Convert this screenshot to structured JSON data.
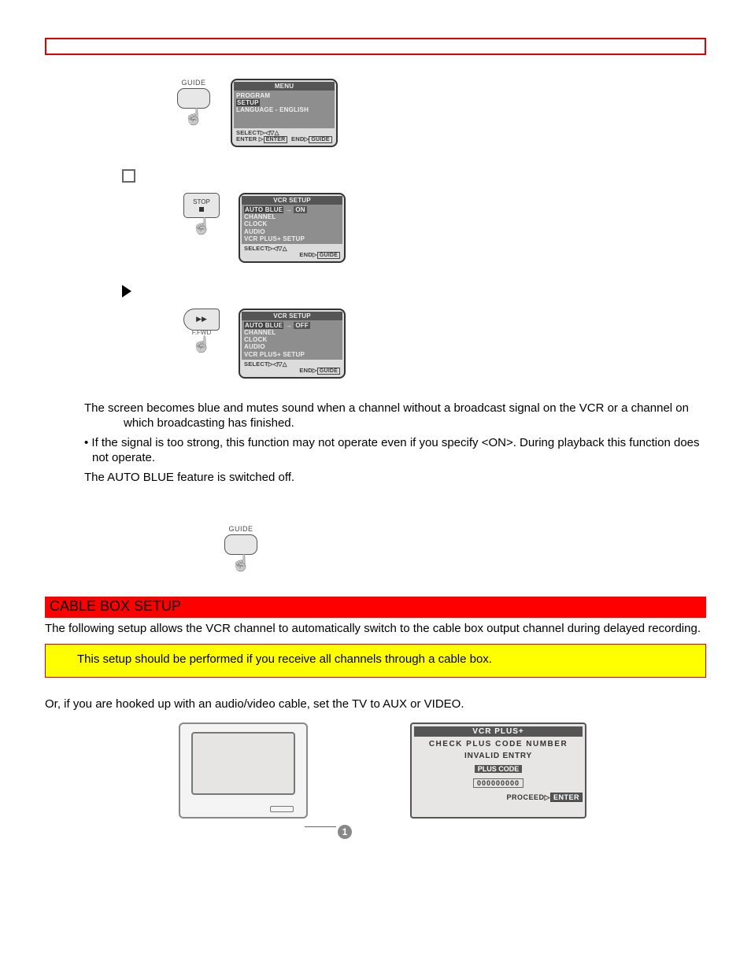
{
  "step1": {
    "remote_label": "GUIDE",
    "osd_title": "MENU",
    "items": [
      "PROGRAM",
      "SETUP",
      "LANGUAGE - ENGLISH"
    ],
    "footer_line1_a": "SELECT",
    "footer_line1_b": "",
    "footer_line2_a": "ENTER",
    "footer_line2_btn1": "ENTER",
    "footer_line2_b": "END",
    "footer_line2_btn2": "GUIDE"
  },
  "step2": {
    "remote_label": "STOP",
    "osd_title": "VCR SETUP",
    "item_sel": "AUTO BLUE",
    "item_val": "ON",
    "items_rest": [
      "CHANNEL",
      "CLOCK",
      "AUDIO",
      "VCR PLUS+  SETUP"
    ],
    "footer_a": "SELECT",
    "footer_end": "END",
    "footer_btn": "GUIDE"
  },
  "step3": {
    "remote_label": "F.FWD",
    "osd_title": "VCR SETUP",
    "item_sel": "AUTO BLUE",
    "item_val": "OFF",
    "items_rest": [
      "CHANNEL",
      "CLOCK",
      "AUDIO",
      "VCR PLUS+  SETUP"
    ],
    "footer_a": "SELECT",
    "footer_end": "END",
    "footer_btn": "GUIDE"
  },
  "notes": {
    "line1": "The screen becomes blue and mutes sound when a channel without a broadcast signal on the VCR or a channel on which broadcasting has finished.",
    "bullet": "If the signal is too strong, this function may not operate even if you specify <ON>. During playback this function does not operate.",
    "line3": "The AUTO BLUE feature is switched off."
  },
  "guide_btn_label": "GUIDE",
  "section_title": "CABLE BOX SETUP",
  "section_body": "The following setup allows the VCR channel to automatically switch to the cable box output channel during delayed recording.",
  "yellow_note": "This setup should be performed if you receive all channels through a cable box.",
  "aux_line": "Or, if you are hooked up with an audio/video cable, set the TV to AUX or VIDEO.",
  "callout_num": "1",
  "pluscode": {
    "title": "VCR PLUS+",
    "row1": "CHECK PLUS CODE NUMBER",
    "row2": "INVALID ENTRY",
    "row3": "PLUS CODE",
    "digits": "000000000",
    "footer_a": "PROCEED",
    "footer_btn": "ENTER"
  }
}
